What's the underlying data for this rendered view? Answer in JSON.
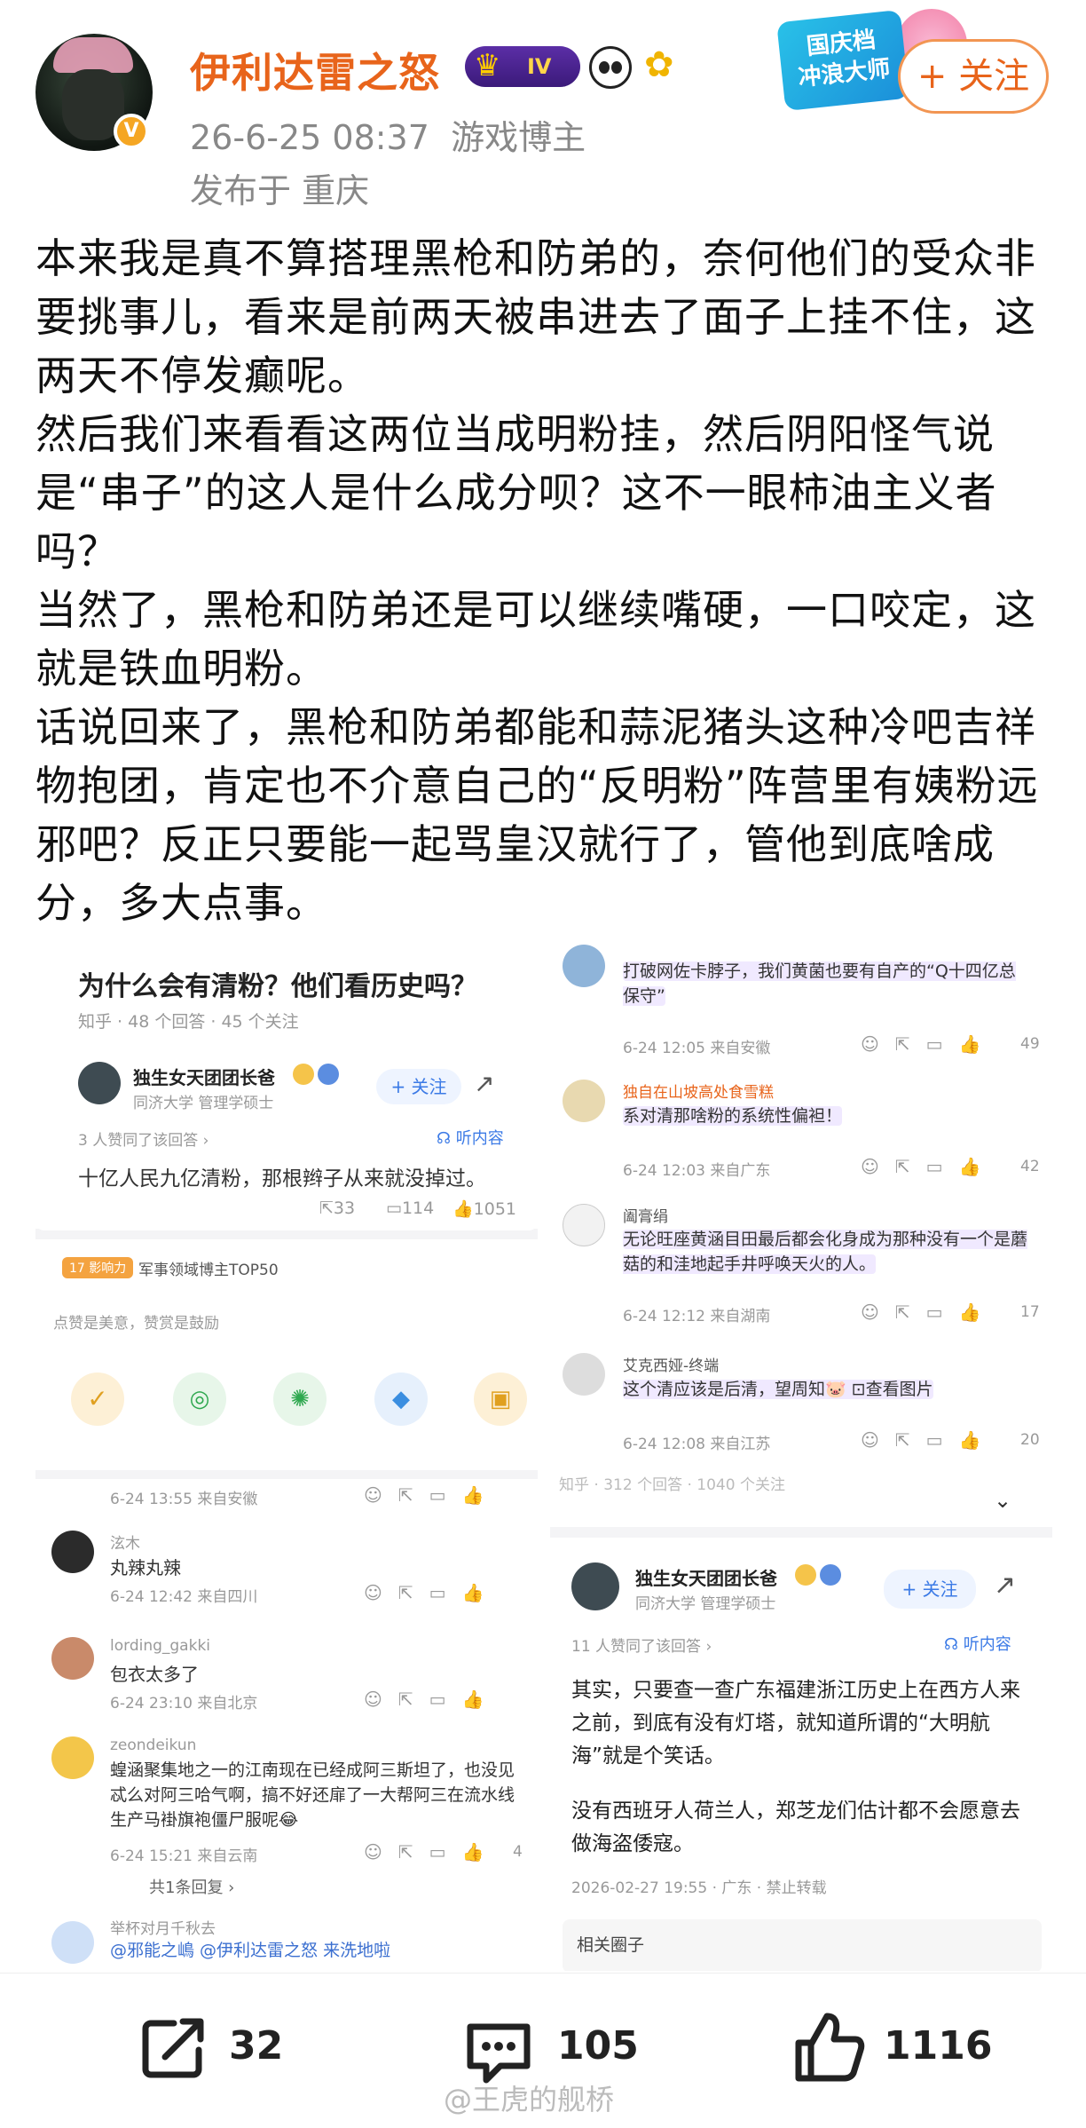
{
  "header": {
    "username": "伊利达雷之怒",
    "level_badge": "IV",
    "verified_mark": "V",
    "timestamp": "26-6-25 08:37",
    "role": "游戏博主",
    "location": "发布于 重庆",
    "promo_text": [
      "国庆档",
      "冲浪大师"
    ],
    "follow_label": "+ 关注"
  },
  "post": {
    "paragraphs": [
      "本来我是真不算搭理黑枪和防弟的，奈何他们的受众非要挑事儿，看来是前两天被串进去了面子上挂不住，这两天不停发癫呢。",
      "然后我们来看看这两位当成明粉挂，然后阴阳怪气说是“串子”的这人是什么成分呗？这不一眼柿油主义者吗？",
      "当然了，黑枪和防弟还是可以继续嘴硬，一口咬定，这就是铁血明粉。",
      "话说回来了，黑枪和防弟都能和蒜泥猪头这种冷吧吉祥物抱团，肯定也不介意自己的“反明粉”阵营里有姨粉远邪吧？反正只要能一起骂皇汉就行了，管他到底啥成分，多大点事。"
    ]
  },
  "left_shot": {
    "question": "为什么会有清粉？他们看历史吗？",
    "q_meta": "知乎 · 48 个回答 · 45 个关注",
    "author": "独生女天团团长爸",
    "author_desc": "同济大学 管理学硕士",
    "follow": "+ 关注",
    "agree": "3 人赞同了该回答 ›",
    "listen": "听内容",
    "answer": "十亿人民九亿清粉，那根辫子从来就没掉过。",
    "stats": [
      "33",
      "114",
      "1051"
    ],
    "badge_tag": "17 影响力",
    "badge_text": "军事领域博主TOP50",
    "like_hint": "点赞是美意，赞赏是鼓励",
    "comments": [
      {
        "meta": "6-24 13:55  来自安徽",
        "name": "",
        "text": ""
      },
      {
        "name": "泫木",
        "text": "丸辣丸辣",
        "meta": "6-24 12:42  来自四川"
      },
      {
        "name": "lording_gakki",
        "text": "包衣太多了",
        "meta": "6-24 23:10  来自北京"
      },
      {
        "name": "zeondeikun",
        "text": "蝗涵聚集地之一的江南现在已经成阿三斯坦了，也没见忒么对阿三哈气啊，搞不好还扉了一大帮阿三在流水线生产马褂旗袍僵尸服呢😂",
        "meta": "6-24 15:21  来自云南",
        "likes": "4"
      },
      {
        "name": "举杯对月千秋去",
        "text": "@邪能之嶋 @伊利达雷之怒  来洗地啦",
        "meta": ""
      }
    ],
    "reply_count": "共1条回复 ›"
  },
  "right_shot": {
    "comments": [
      {
        "name": "",
        "text": "打破网佐卡脖子，我们黄菌也要有自产的“Q十四亿总保守”",
        "meta": "6-24 12:05  来自安徽",
        "likes": "49"
      },
      {
        "name": "独自在山坡高处食雪糕",
        "text": "系对清那啥粉的系统性偏袒！",
        "meta": "6-24 12:03  来自广东",
        "likes": "42"
      },
      {
        "name": "阖膏绢",
        "text": "无论旺座黄涵目田最后都会化身成为那种没有一个是蘑菇的和洼地起手井呼唤天火的人。",
        "meta": "6-24 12:12  来自湖南",
        "likes": "17"
      },
      {
        "name": "艾克西娅-终端",
        "text": "这个清应该是后清，望周知🐷 ⊡查看图片",
        "meta": "6-24 12:08  来自江苏",
        "likes": "20"
      }
    ],
    "truncated": "知乎 · 312 个回答 · 1040 个关注",
    "author": "独生女天团团长爸",
    "author_desc": "同济大学 管理学硕士",
    "follow": "+ 关注",
    "agree": "11 人赞同了该回答 ›",
    "listen": "听内容",
    "answer_p1": "其实，只要查一查广东福建浙江历史上在西方人来之前，到底有没有灯塔，就知道所谓的“大明航海”就是个笑话。",
    "answer_p2": "没有西班牙人荷兰人，郑芝龙们估计都不会愿意去做海盗倭寇。",
    "answer_meta": "2026-02-27 19:55 · 广东 · 禁止转载",
    "related": "相关圈子"
  },
  "bottom_bar": {
    "share_count": "32",
    "comment_count": "105",
    "like_count": "1116",
    "watermark": "@王虎的舰桥"
  },
  "colors": {
    "accent_orange": "#e8641b",
    "link_blue": "#3b7ae6"
  }
}
